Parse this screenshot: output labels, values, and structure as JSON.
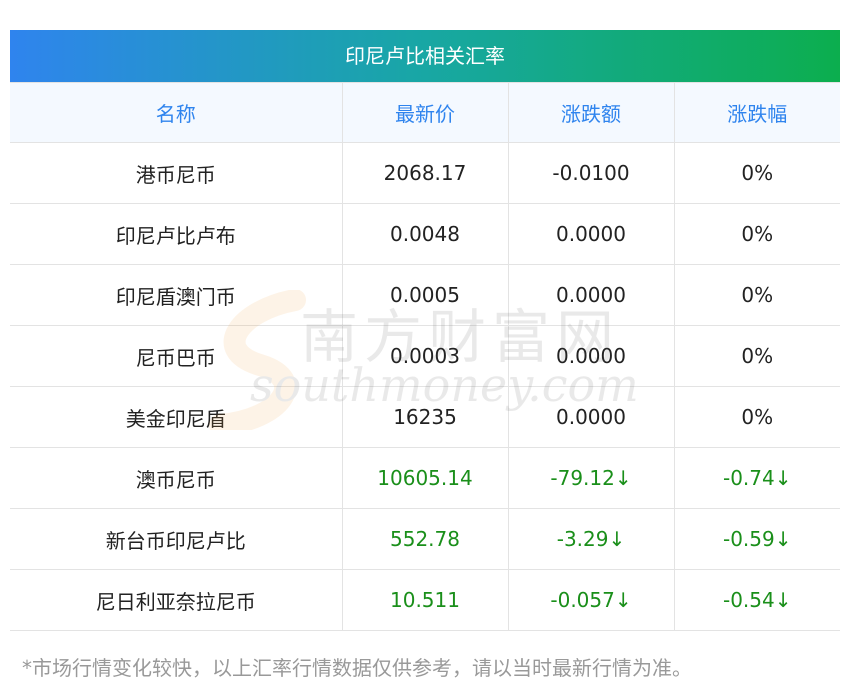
{
  "title": "印尼卢比相关汇率",
  "headers": [
    "名称",
    "最新价",
    "涨跌额",
    "涨跌幅"
  ],
  "rows": [
    {
      "name": "港币尼币",
      "price": "2068.17",
      "change": "-0.0100",
      "pct": "0%",
      "trend": "flat"
    },
    {
      "name": "印尼卢比卢布",
      "price": "0.0048",
      "change": "0.0000",
      "pct": "0%",
      "trend": "flat"
    },
    {
      "name": "印尼盾澳门币",
      "price": "0.0005",
      "change": "0.0000",
      "pct": "0%",
      "trend": "flat"
    },
    {
      "name": "尼币巴币",
      "price": "0.0003",
      "change": "0.0000",
      "pct": "0%",
      "trend": "flat"
    },
    {
      "name": "美金印尼盾",
      "price": "16235",
      "change": "0.0000",
      "pct": "0%",
      "trend": "flat"
    },
    {
      "name": "澳币尼币",
      "price": "10605.14",
      "change": "-79.12↓",
      "pct": "-0.74↓",
      "trend": "down"
    },
    {
      "name": "新台币印尼卢比",
      "price": "552.78",
      "change": "-3.29↓",
      "pct": "-0.59↓",
      "trend": "down"
    },
    {
      "name": "尼日利亚奈拉尼币",
      "price": "10.511",
      "change": "-0.057↓",
      "pct": "-0.54↓",
      "trend": "down"
    }
  ],
  "footnote": "*市场行情变化较快，以上汇率行情数据仅供参考，请以当时最新行情为准。",
  "watermark": {
    "cn": "南方财富网",
    "en": "southmoney.com"
  },
  "colors": {
    "header_text": "#2f84ee",
    "down": "#1a8f1a",
    "gradient_start": "#2f84ee",
    "gradient_end": "#0cae4e"
  }
}
